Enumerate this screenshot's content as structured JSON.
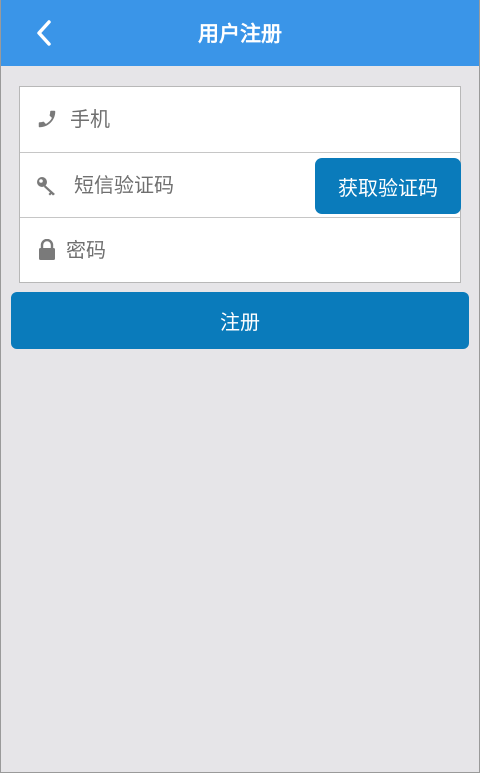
{
  "header": {
    "title": "用户注册",
    "back_icon": "chevron-left-icon",
    "background_color": "#3a95e8"
  },
  "form": {
    "phone": {
      "icon": "phone-icon",
      "placeholder": "手机",
      "value": ""
    },
    "sms_code": {
      "icon": "key-icon",
      "placeholder": "短信验证码",
      "value": "",
      "get_code_label": "获取验证码"
    },
    "password": {
      "icon": "lock-icon",
      "placeholder": "密码",
      "value": ""
    }
  },
  "register_button": {
    "label": "注册",
    "color": "#0a7bbb"
  },
  "page": {
    "background_color": "#e6e5e8"
  }
}
